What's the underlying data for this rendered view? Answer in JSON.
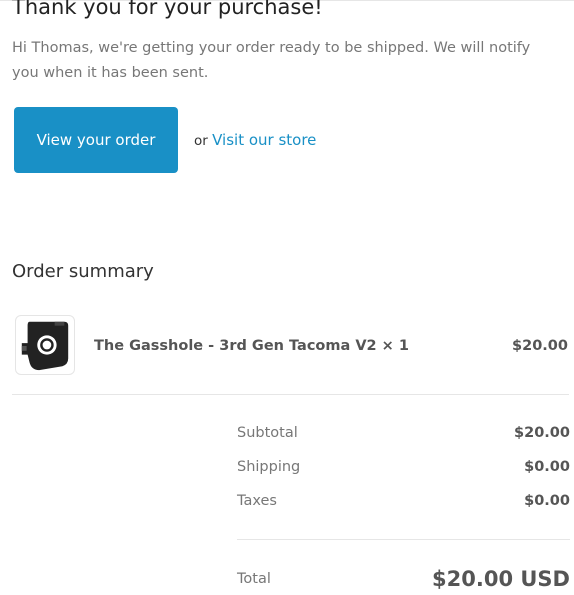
{
  "header": {
    "title": "Thank you for your purchase!",
    "message": "Hi Thomas, we're getting your order ready to be shipped. We will notify you when it has been sent."
  },
  "actions": {
    "view_order_label": "View your order",
    "or_text": "or",
    "visit_store_label": "Visit our store"
  },
  "summary": {
    "heading": "Order summary",
    "items": [
      {
        "name": "The Gasshole - 3rd Gen Tacoma V2 × 1",
        "price": "$20.00",
        "image_icon": "fuel-door-part-icon"
      }
    ],
    "subtotal_label": "Subtotal",
    "subtotal_value": "$20.00",
    "shipping_label": "Shipping",
    "shipping_value": "$0.00",
    "taxes_label": "Taxes",
    "taxes_value": "$0.00",
    "total_label": "Total",
    "total_value": "$20.00 USD"
  },
  "colors": {
    "accent": "#1990c6",
    "text": "#333333",
    "muted": "#777777",
    "divider": "#e6e6e6"
  }
}
